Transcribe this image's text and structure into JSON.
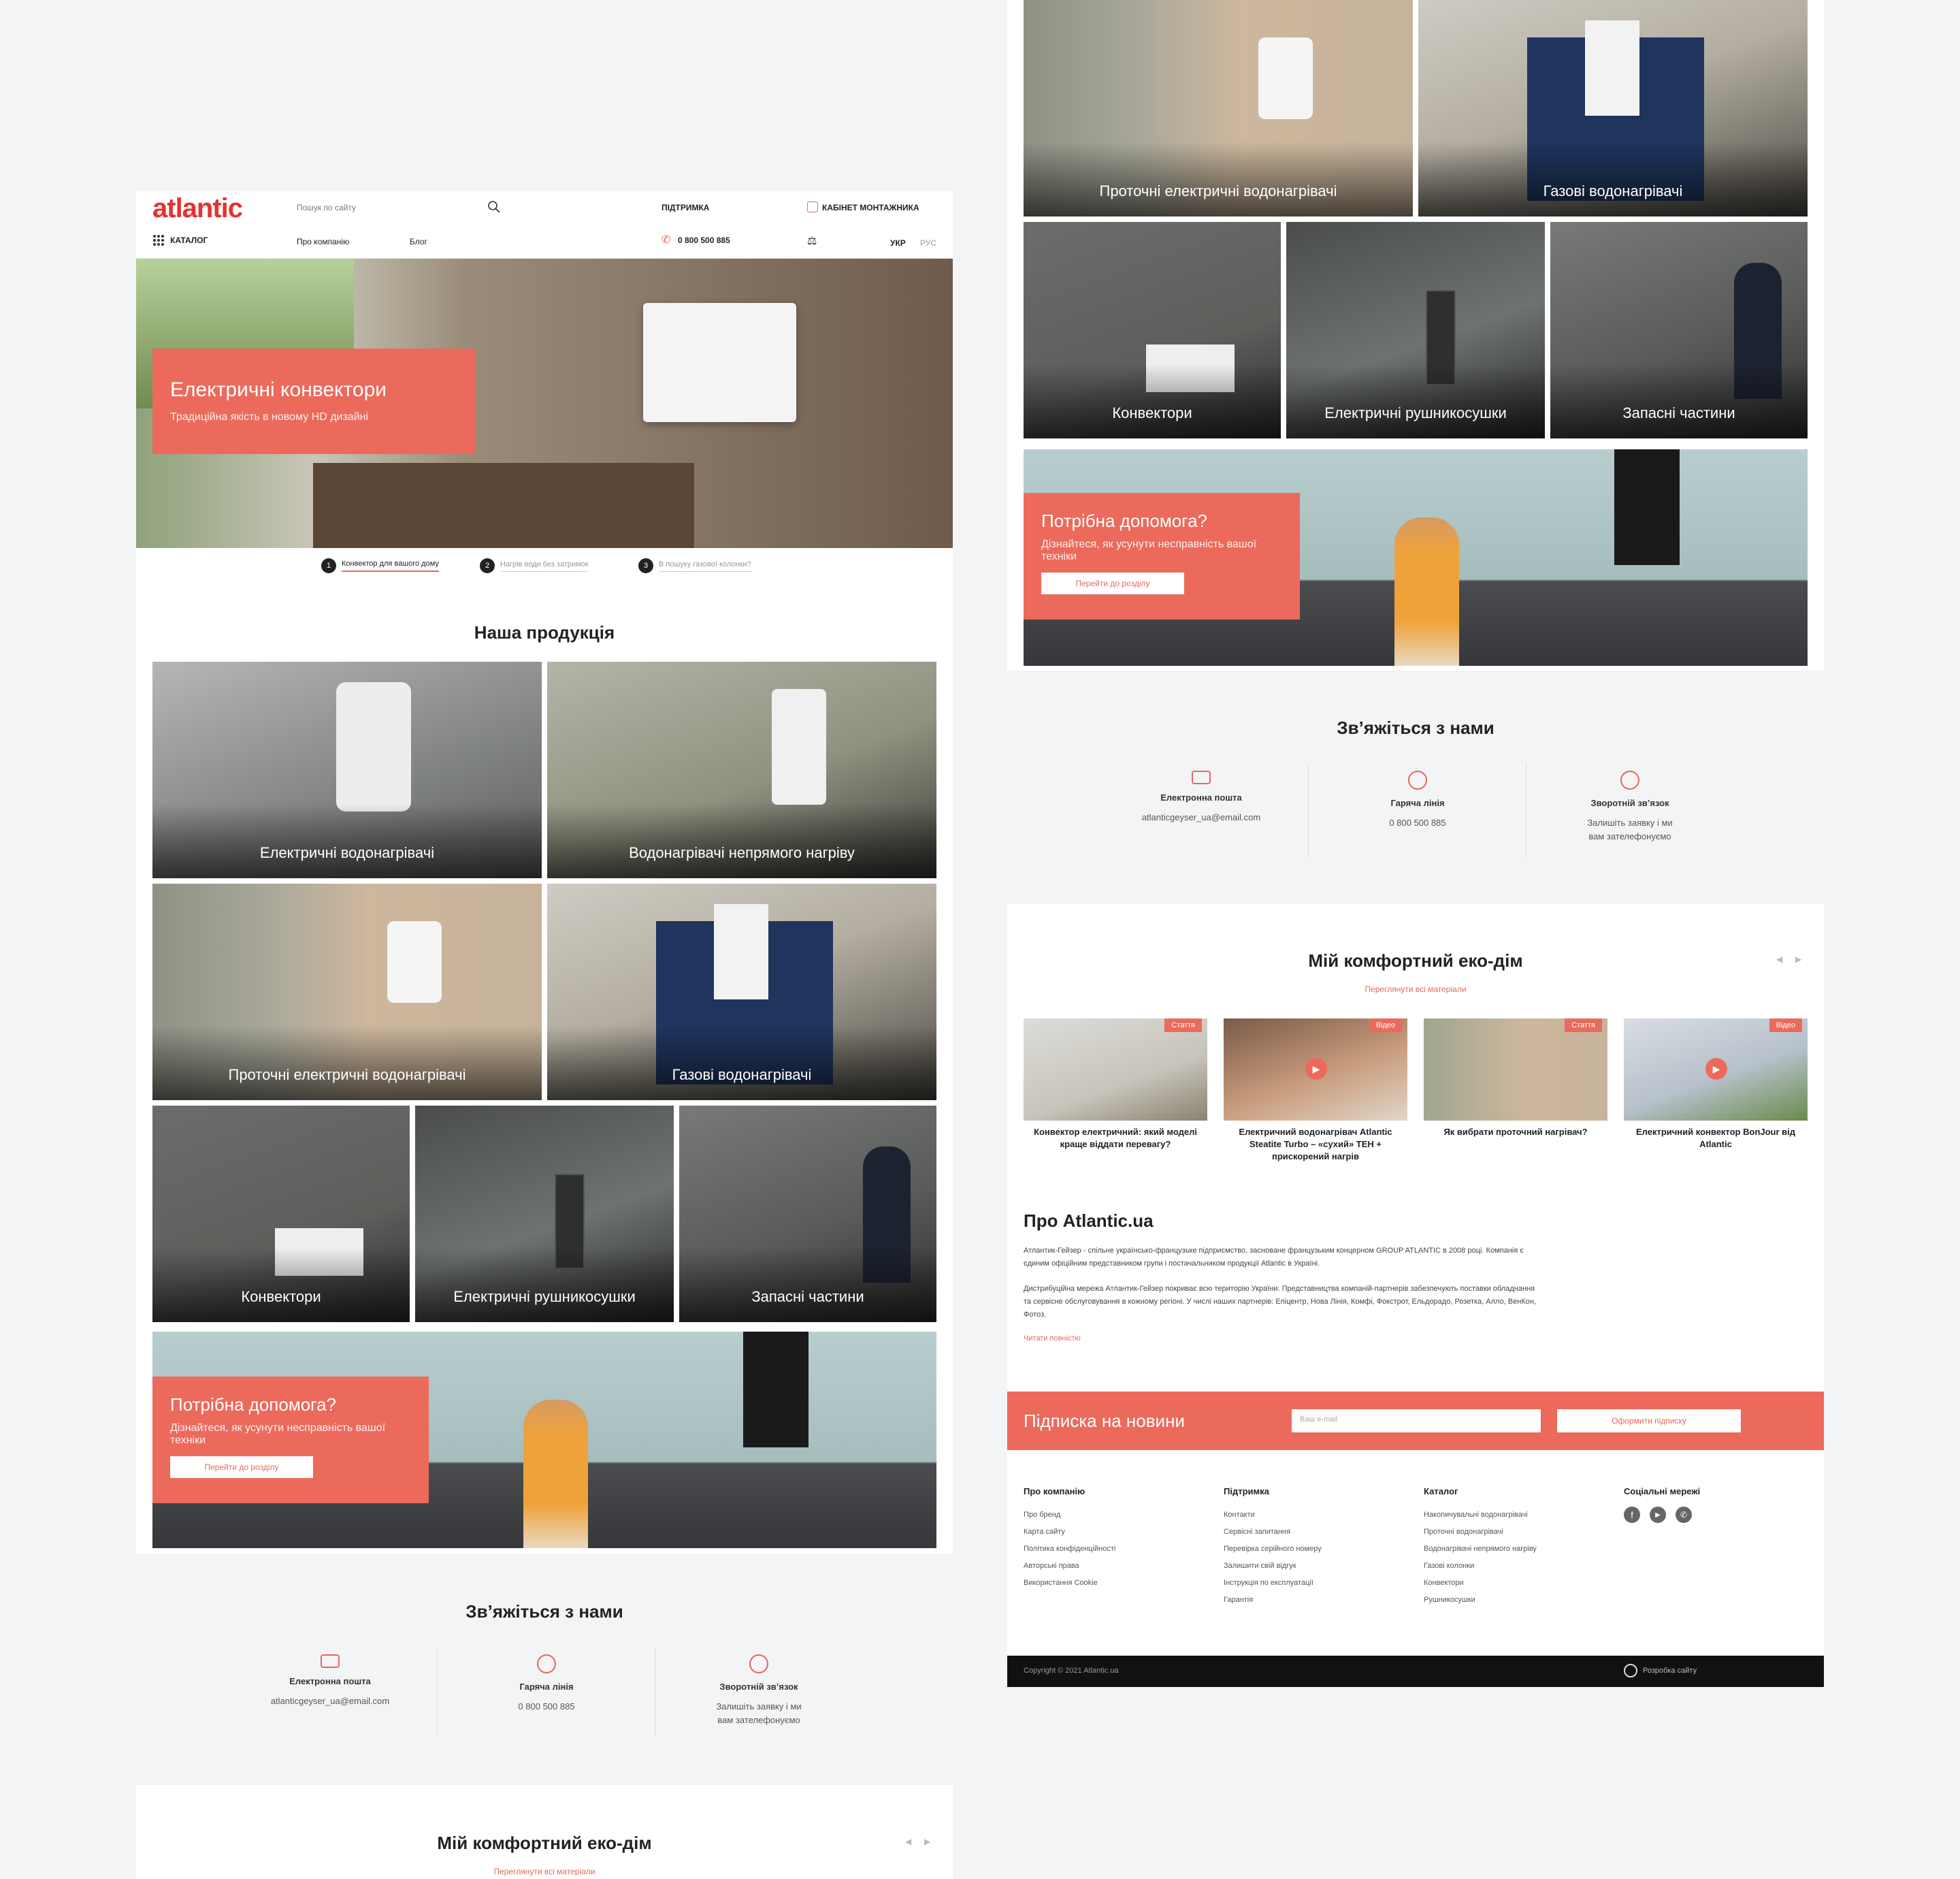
{
  "header": {
    "logo": "atlantic",
    "search_placeholder": "Пошук по сайту",
    "support": "ПІДТРИМКА",
    "installer_cabinet": "КАБІНЕТ МОНТАЖНИКА",
    "catalog": "КАТАЛОГ",
    "about": "Про компанію",
    "blog": "Блог",
    "phone": "0 800 500 885",
    "lang_ukr": "УКР",
    "lang_rus": "РУС"
  },
  "hero": {
    "title": "Електричні конвектори",
    "subtitle": "Традиційна якість в новому HD дизайні",
    "steps": [
      {
        "n": "1",
        "label": "Конвектор для вашого дому"
      },
      {
        "n": "2",
        "label": "Нагрів води без затримок"
      },
      {
        "n": "3",
        "label": "В пошуку газової колонки?"
      }
    ]
  },
  "products": {
    "title": "Наша продукція",
    "items": [
      "Електричні водонагрівачі",
      "Водонагрівачі непрямого нагріву",
      "Проточні електричні водонагрівачі",
      "Газові водонагрівачі",
      "Конвектори",
      "Електричні рушникосушки",
      "Запасні частини"
    ]
  },
  "help": {
    "title": "Потрібна допомога?",
    "text": "Дізнайтеся, як усунути несправність вашої техніки",
    "button": "Перейти до розділу"
  },
  "contact": {
    "title": "Зв’яжіться з нами",
    "email_label": "Електронна пошта",
    "email": "atlanticgeyser_ua@email.com",
    "hotline_label": "Гаряча лінія",
    "hotline": "0 800 500 885",
    "callback_label": "Зворотній зв’язок",
    "callback_text": "Залишіть заявку і ми вам зателефонуємо"
  },
  "eco": {
    "title": "Мій комфортний еко-дім",
    "all_link": "Переглянути всі матеріали",
    "prev": "◀",
    "next": "▶",
    "cards": [
      {
        "badge": "Стаття",
        "title": "Конвектор електричний: який моделі краще віддати перевагу?"
      },
      {
        "badge": "Відео",
        "title": "Електричний водонагрівач Atlantic Steatite Turbo – «сухий» ТЕН + прискорений нагрів"
      },
      {
        "badge": "Стаття",
        "title": "Як вибрати проточний нагрівач?"
      },
      {
        "badge": "Відео",
        "title": "Електричний конвектор BonJour від Atlantic"
      }
    ]
  },
  "about": {
    "title": "Про Atlantic.ua",
    "p1": "Атлантик-Гейзер - спільне українсько-французьке підприємство, засноване французьким концерном GROUP ATLANTIC в 2008 році. Компанія є єдиним офіційним представником групи і постачальником продукції Atlantic в Україні.",
    "p2": "Дистрибуційна мережа Атлантик-Гейзер покриває всю територію України. Представництва компаній-партнерів забезпечують поставки обладнання та сервісне обслуговування в кожному регіоні. У числі наших партнерів: Епіцентр, Нова Лінія, Комфі, Фокстрот, Ельдорадо, Розетка, Алло, ВенКон, Фотоз.",
    "more": "Читати повністю"
  },
  "subscribe": {
    "title": "Підписка на новини",
    "placeholder": "Ваш e-mail",
    "button": "Оформити підписку"
  },
  "footer": {
    "col1": {
      "h": "Про компанію",
      "items": [
        "Про бренд",
        "Карта сайту",
        "Політика конфіденційності",
        "Авторські права",
        "Використання Cookie"
      ]
    },
    "col2": {
      "h": "Підтримка",
      "items": [
        "Контакти",
        "Сервісні запитання",
        "Перевірка серійного номеру",
        "Залишити свій відгук",
        "Інструкція по експлуатації",
        "Гарантія"
      ]
    },
    "col3": {
      "h": "Каталог",
      "items": [
        "Накопичувальні водонагрівачі",
        "Проточні водонагрівачі",
        "Водонагрівачі непрямого нагріву",
        "Газові колонки",
        "Конвектори",
        "Рушникосушки"
      ]
    },
    "col4": {
      "h": "Соціальні мережі"
    },
    "copyright": "Copyright © 2021 Atlantic.ua",
    "dev": "Розробка сайту"
  },
  "colors": {
    "accent": "#ec6a5c",
    "brand": "#e5322d",
    "dark": "#111111"
  }
}
